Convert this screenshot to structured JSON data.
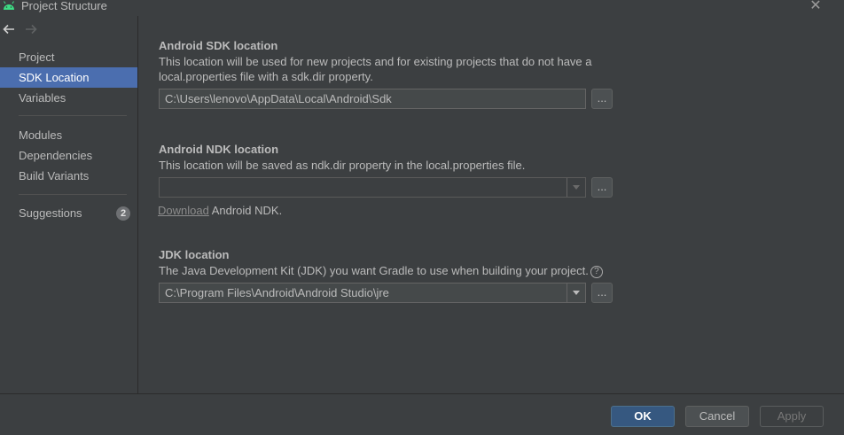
{
  "window": {
    "title": "Project Structure"
  },
  "sidebar": {
    "items": [
      {
        "label": "Project"
      },
      {
        "label": "SDK Location",
        "selected": true
      },
      {
        "label": "Variables"
      },
      {
        "label": "Modules"
      },
      {
        "label": "Dependencies"
      },
      {
        "label": "Build Variants"
      },
      {
        "label": "Suggestions",
        "badge": "2"
      }
    ]
  },
  "sdk": {
    "title": "Android SDK location",
    "desc_line1": "This location will be used for new projects and for existing projects that do not have a",
    "desc_line2": "local.properties file with a sdk.dir property.",
    "value": "C:\\Users\\lenovo\\AppData\\Local\\Android\\Sdk",
    "browse": "..."
  },
  "ndk": {
    "title": "Android NDK location",
    "desc": "This location will be saved as ndk.dir property in the local.properties file.",
    "value": "",
    "browse": "...",
    "download_link": "Download",
    "download_suffix": " Android NDK."
  },
  "jdk": {
    "title": "JDK location",
    "desc": "The Java Development Kit (JDK) you want Gradle to use when building your project.",
    "help": "?",
    "value": "C:\\Program Files\\Android\\Android Studio\\jre",
    "browse": "..."
  },
  "buttons": {
    "ok": "OK",
    "cancel": "Cancel",
    "apply": "Apply"
  },
  "colors": {
    "selection": "#4b6eaf",
    "ok_button": "#365880",
    "android_green": "#3ddc84"
  }
}
